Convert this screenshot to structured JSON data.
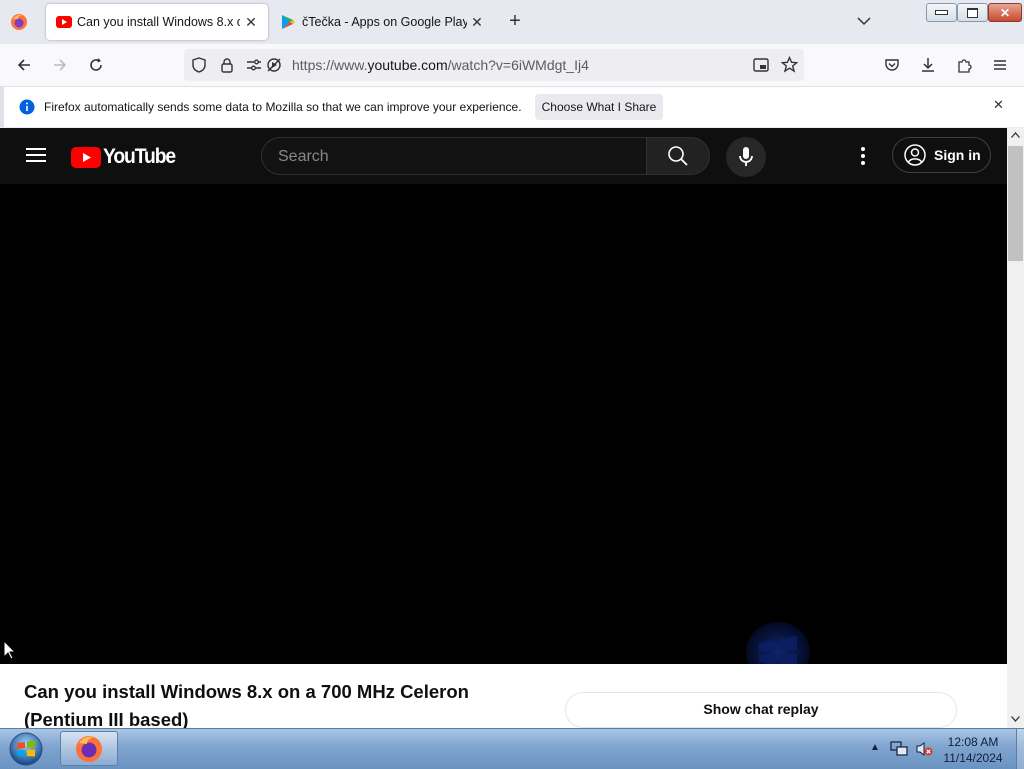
{
  "browser": {
    "tabs": [
      {
        "title": "Can you install Windows 8.x on a 700 MHz Celeron (Pentium III based)",
        "active": true
      },
      {
        "title": "čTečka - Apps on Google Play",
        "active": false
      }
    ],
    "url": {
      "prefix": "https://www.",
      "host": "youtube.com",
      "path": "/watch?v=6iWMdgt_Ij4"
    },
    "notification": {
      "text": "Firefox automatically sends some data to Mozilla so that we can improve your experience.",
      "button": "Choose What I Share"
    }
  },
  "youtube": {
    "logo_text": "YouTube",
    "search_placeholder": "Search",
    "sign_in": "Sign in",
    "video_title": "Can you install Windows 8.x on a 700 MHz Celeron (Pentium III based)",
    "chat_button": "Show chat replay"
  },
  "taskbar": {
    "time": "12:08 AM",
    "date": "11/14/2024"
  },
  "colors": {
    "youtube_red": "#ff0000",
    "player_bg": "#000000",
    "header_bg": "#0f0f0f"
  }
}
